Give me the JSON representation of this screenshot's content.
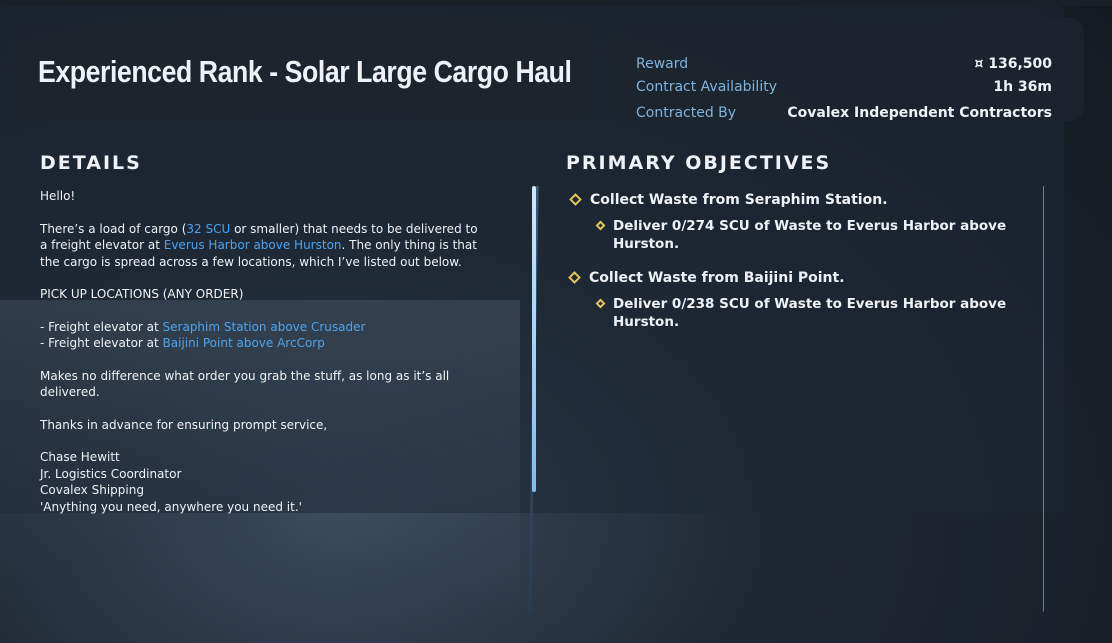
{
  "contract": {
    "title": "Experienced Rank - Solar Large Cargo Haul"
  },
  "info": {
    "reward_label": "Reward",
    "reward_value": "¤ 136,500",
    "availability_label": "Contract Availability",
    "availability_value": "1h 36m",
    "contracted_by_label": "Contracted By",
    "contracted_by_value": "Covalex Independent Contractors"
  },
  "details": {
    "heading": "DETAILS",
    "greeting": "Hello!",
    "para1_a": "There’s a load of cargo (",
    "para1_hl1": "32 SCU",
    "para1_b": " or smaller) that needs to be delivered to a freight elevator at ",
    "para1_hl2": "Everus Harbor above Hurston",
    "para1_c": ". The only thing is that the cargo is spread across a few locations, which I’ve listed out below.",
    "pickup_heading": "PICK UP LOCATIONS (ANY ORDER)",
    "pickup1_prefix": "- Freight elevator at ",
    "pickup1_location": "Seraphim Station above Crusader",
    "pickup2_prefix": "- Freight elevator at ",
    "pickup2_location": "Baijini Point above ArcCorp",
    "para2": "Makes no difference what order you grab the stuff, as long as it’s all delivered.",
    "thanks": "Thanks in advance for ensuring prompt service,",
    "sig_name": "Chase Hewitt",
    "sig_title": "Jr. Logistics Coordinator",
    "sig_company": "Covalex Shipping",
    "sig_motto": "'Anything you need, anywhere you need it.'"
  },
  "objectives": {
    "heading": "PRIMARY OBJECTIVES",
    "items": [
      {
        "label": "Collect Waste from Seraphim Station.",
        "sub": "Deliver 0/274 SCU of Waste to Everus Harbor above Hurston."
      },
      {
        "label": "Collect Waste from Baijini Point.",
        "sub": "Deliver 0/238 SCU of Waste to Everus Harbor above Hurston."
      }
    ]
  },
  "colors": {
    "accent": "#4da3ef",
    "label": "#7fb3df",
    "objective_marker": "#e2c35a"
  }
}
